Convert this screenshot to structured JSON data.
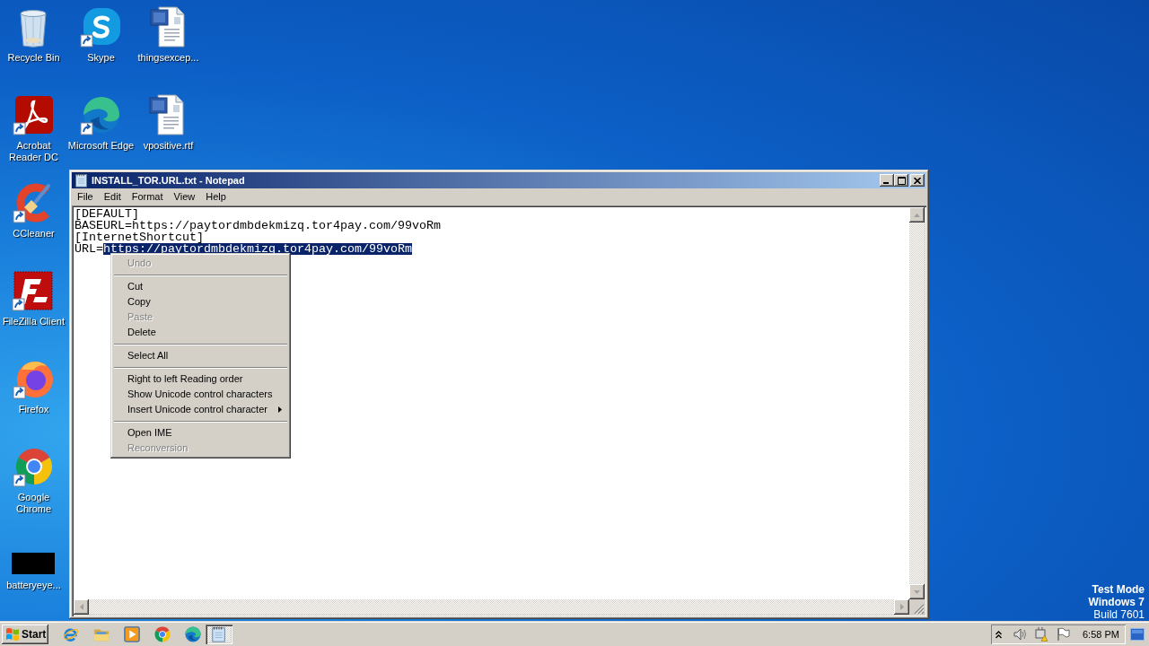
{
  "desktop": {
    "icon_columns": [
      [
        {
          "label": "Recycle Bin",
          "kind": "recycle_bin",
          "shortcut": false
        },
        {
          "label": "Acrobat Reader DC",
          "kind": "acrobat",
          "shortcut": true
        },
        {
          "label": "CCleaner",
          "kind": "ccleaner",
          "shortcut": true
        },
        {
          "label": "FileZilla Client",
          "kind": "filezilla",
          "shortcut": true
        },
        {
          "label": "Firefox",
          "kind": "firefox",
          "shortcut": true
        },
        {
          "label": "Google Chrome",
          "kind": "chrome",
          "shortcut": true
        },
        {
          "label": "batteryeye...",
          "kind": "blank",
          "shortcut": false
        }
      ],
      [
        {
          "label": "Skype",
          "kind": "skype",
          "shortcut": true
        },
        {
          "label": "Microsoft Edge",
          "kind": "edge",
          "shortcut": true
        }
      ],
      [
        {
          "label": "thingsexcep...",
          "kind": "document",
          "shortcut": false
        },
        {
          "label": "vpositive.rtf",
          "kind": "document",
          "shortcut": false
        }
      ]
    ],
    "os_notice": [
      {
        "text": "Test Mode",
        "kind": "bold"
      },
      {
        "text": "Windows 7",
        "kind": "bold"
      },
      {
        "text": "Build 7601",
        "kind": "plain"
      }
    ]
  },
  "window": {
    "title": "INSTALL_TOR.URL.txt - Notepad",
    "menu": [
      "File",
      "Edit",
      "Format",
      "View",
      "Help"
    ],
    "lines": [
      {
        "segments": [
          {
            "text": "[DEFAULT]",
            "selected": false
          }
        ]
      },
      {
        "segments": [
          {
            "text": "BASEURL=https://paytordmbdekmizq.tor4pay.com/99voRm",
            "selected": false
          }
        ]
      },
      {
        "segments": [
          {
            "text": "[InternetShortcut]",
            "selected": false
          }
        ]
      },
      {
        "segments": [
          {
            "text": "URL=",
            "selected": false
          },
          {
            "text": "https://paytordmbdekmizq.tor4pay.com/99voRm",
            "selected": true
          }
        ]
      }
    ]
  },
  "context_menu": {
    "items": [
      {
        "kind": "item",
        "label": "Undo",
        "disabled": true,
        "submenu": false
      },
      {
        "kind": "separator"
      },
      {
        "kind": "item",
        "label": "Cut",
        "disabled": false,
        "submenu": false
      },
      {
        "kind": "item",
        "label": "Copy",
        "disabled": false,
        "submenu": false
      },
      {
        "kind": "item",
        "label": "Paste",
        "disabled": true,
        "submenu": false
      },
      {
        "kind": "item",
        "label": "Delete",
        "disabled": false,
        "submenu": false
      },
      {
        "kind": "separator"
      },
      {
        "kind": "item",
        "label": "Select All",
        "disabled": false,
        "submenu": false
      },
      {
        "kind": "separator"
      },
      {
        "kind": "item",
        "label": "Right to left Reading order",
        "disabled": false,
        "submenu": false
      },
      {
        "kind": "item",
        "label": "Show Unicode control characters",
        "disabled": false,
        "submenu": false
      },
      {
        "kind": "item",
        "label": "Insert Unicode control character",
        "disabled": false,
        "submenu": true
      },
      {
        "kind": "separator"
      },
      {
        "kind": "item",
        "label": "Open IME",
        "disabled": false,
        "submenu": false
      },
      {
        "kind": "item",
        "label": "Reconversion",
        "disabled": true,
        "submenu": false
      }
    ]
  },
  "taskbar": {
    "start": "Start",
    "apps": [
      {
        "kind": "ie",
        "selected": false
      },
      {
        "kind": "folder",
        "selected": false
      },
      {
        "kind": "media",
        "selected": false
      },
      {
        "kind": "chrome",
        "selected": false
      },
      {
        "kind": "edge",
        "selected": false
      },
      {
        "kind": "notepad",
        "selected": true
      }
    ],
    "clock": "6:58 PM"
  }
}
